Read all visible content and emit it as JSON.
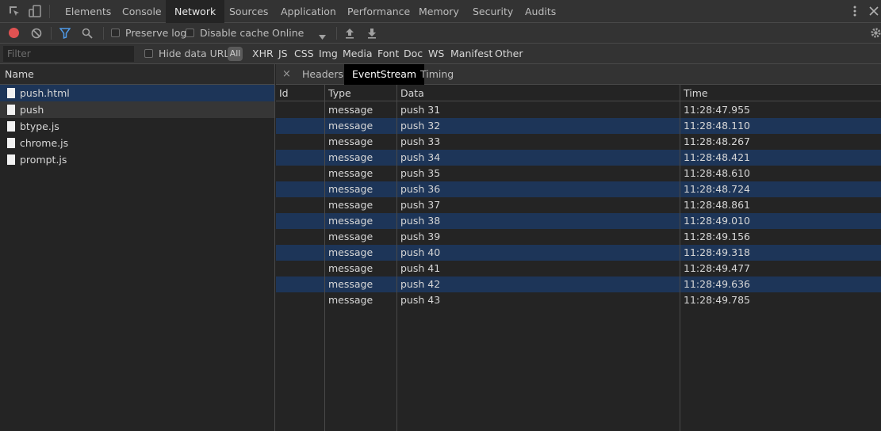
{
  "main_tabs": [
    {
      "label": "Elements"
    },
    {
      "label": "Console"
    },
    {
      "label": "Network",
      "active": true
    },
    {
      "label": "Sources"
    },
    {
      "label": "Application"
    },
    {
      "label": "Performance"
    },
    {
      "label": "Memory"
    },
    {
      "label": "Security"
    },
    {
      "label": "Audits"
    }
  ],
  "toolbar": {
    "preserve_log_label": "Preserve log",
    "disable_cache_label": "Disable cache",
    "throttle_value": "Online",
    "record_color": "#e05252",
    "filter_color": "#4f9ae8"
  },
  "filterbar": {
    "placeholder": "Filter",
    "hide_data_urls_label": "Hide data URLs",
    "all_label": "All",
    "types": [
      "XHR",
      "JS",
      "CSS",
      "Img",
      "Media",
      "Font",
      "Doc",
      "WS",
      "Manifest",
      "Other"
    ]
  },
  "requests": {
    "header": "Name",
    "files": [
      {
        "name": "push.html",
        "state": "selected"
      },
      {
        "name": "push",
        "state": "hover"
      },
      {
        "name": "btype.js",
        "state": ""
      },
      {
        "name": "chrome.js",
        "state": ""
      },
      {
        "name": "prompt.js",
        "state": ""
      }
    ]
  },
  "detail": {
    "close": "×",
    "tabs": [
      {
        "label": "Headers"
      },
      {
        "label": "EventStream",
        "active": true
      },
      {
        "label": "Timing"
      }
    ]
  },
  "eventstream": {
    "columns": {
      "id": "Id",
      "type": "Type",
      "data": "Data",
      "time": "Time"
    },
    "rows": [
      {
        "id": "",
        "type": "message",
        "data": "push 31",
        "time": "11:28:47.955"
      },
      {
        "id": "",
        "type": "message",
        "data": "push 32",
        "time": "11:28:48.110"
      },
      {
        "id": "",
        "type": "message",
        "data": "push 33",
        "time": "11:28:48.267"
      },
      {
        "id": "",
        "type": "message",
        "data": "push 34",
        "time": "11:28:48.421"
      },
      {
        "id": "",
        "type": "message",
        "data": "push 35",
        "time": "11:28:48.610"
      },
      {
        "id": "",
        "type": "message",
        "data": "push 36",
        "time": "11:28:48.724"
      },
      {
        "id": "",
        "type": "message",
        "data": "push 37",
        "time": "11:28:48.861"
      },
      {
        "id": "",
        "type": "message",
        "data": "push 38",
        "time": "11:28:49.010"
      },
      {
        "id": "",
        "type": "message",
        "data": "push 39",
        "time": "11:28:49.156"
      },
      {
        "id": "",
        "type": "message",
        "data": "push 40",
        "time": "11:28:49.318"
      },
      {
        "id": "",
        "type": "message",
        "data": "push 41",
        "time": "11:28:49.477"
      },
      {
        "id": "",
        "type": "message",
        "data": "push 42",
        "time": "11:28:49.636"
      },
      {
        "id": "",
        "type": "message",
        "data": "push 43",
        "time": "11:28:49.785"
      }
    ]
  }
}
